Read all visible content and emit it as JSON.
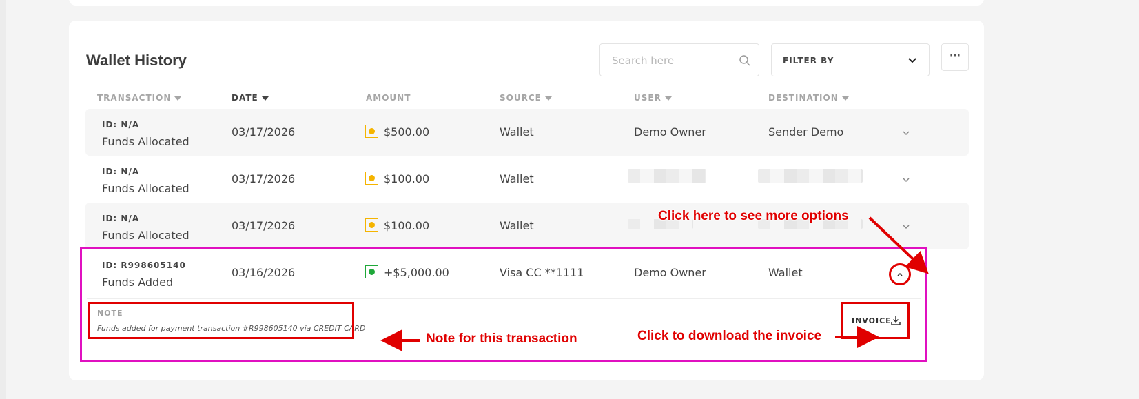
{
  "wallet_history": {
    "title": "Wallet History",
    "search_placeholder": "Search here",
    "filter_label": "FILTER BY",
    "more_label": "···",
    "columns": [
      {
        "label": "TRANSACTION",
        "sortable": true,
        "active": false
      },
      {
        "label": "DATE",
        "sortable": true,
        "active": true
      },
      {
        "label": "AMOUNT",
        "sortable": false,
        "active": false
      },
      {
        "label": "SOURCE",
        "sortable": true,
        "active": false
      },
      {
        "label": "USER",
        "sortable": true,
        "active": false
      },
      {
        "label": "DESTINATION",
        "sortable": true,
        "active": false
      }
    ],
    "rows": [
      {
        "id": "ID: N/A",
        "type": "Funds Allocated",
        "date": "03/17/2026",
        "amount": "$500.00",
        "amount_icon": "yellow-dot-icon",
        "source": "Wallet",
        "user": "Demo Owner",
        "destination": "Sender Demo"
      },
      {
        "id": "ID: N/A",
        "type": "Funds Allocated",
        "date": "03/17/2026",
        "amount": "$100.00",
        "amount_icon": "yellow-dot-icon",
        "source": "Wallet",
        "user": "",
        "destination": ""
      },
      {
        "id": "ID: N/A",
        "type": "Funds Allocated",
        "date": "03/17/2026",
        "amount": "$100.00",
        "amount_icon": "yellow-dot-icon",
        "source": "Wallet",
        "user": "",
        "destination": ""
      },
      {
        "id": "ID: R998605140",
        "type": "Funds Added",
        "date": "03/16/2026",
        "amount": "+$5,000.00",
        "amount_icon": "green-dot-icon",
        "source": "Visa CC **1111",
        "user": "Demo Owner",
        "destination": "Wallet"
      }
    ],
    "expanded": {
      "note_label": "NOTE",
      "note_text": "Funds added for payment transaction #R998605140 via CREDIT CARD",
      "invoice_label": "INVOICE"
    }
  },
  "annotations": {
    "more_options": "Click here to see more options",
    "note": "Note for this transaction",
    "invoice": "Click to download the invoice"
  },
  "colors": {
    "annotation_red": "#e00000",
    "highlight_magenta": "#e010c0",
    "yellow": "#f5b400",
    "green": "#1fa83a"
  }
}
